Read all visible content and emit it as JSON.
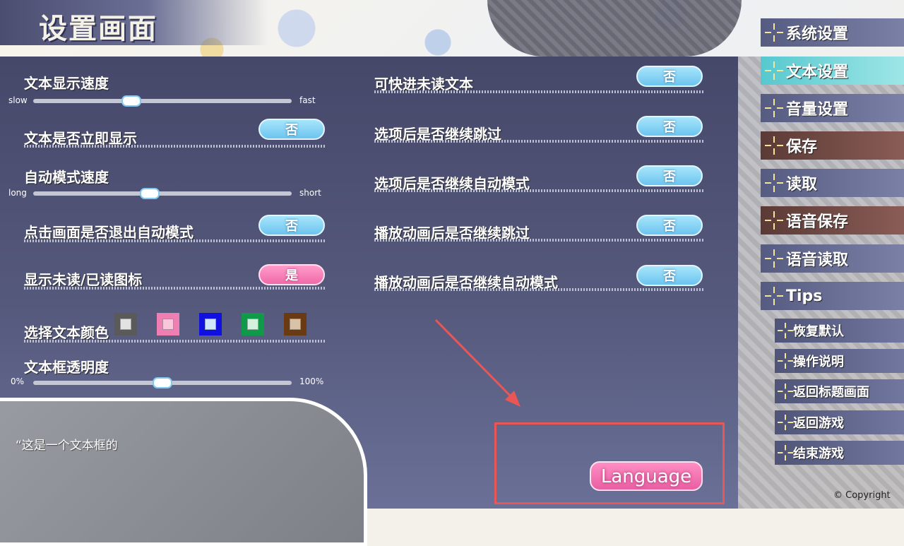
{
  "header": {
    "title": "设置画面"
  },
  "left_settings": {
    "text_speed": {
      "label": "文本显示速度",
      "min_label": "slow",
      "max_label": "fast",
      "value_pct": 38
    },
    "instant_text": {
      "label": "文本是否立即显示",
      "value": "否"
    },
    "auto_speed": {
      "label": "自动模式速度",
      "min_label": "long",
      "max_label": "short",
      "value_pct": 45
    },
    "click_exit_auto": {
      "label": "点击画面是否退出自动模式",
      "value": "否"
    },
    "show_read_icon": {
      "label": "显示未读/已读图标",
      "value": "是"
    },
    "text_color": {
      "label": "选择文本颜色",
      "swatches": [
        {
          "name": "gray",
          "border": "#5a5a5a",
          "fill": "#e2e2e2"
        },
        {
          "name": "pink",
          "border": "#ef7fb2",
          "fill": "#f9c6dc"
        },
        {
          "name": "blue",
          "border": "#1010e0",
          "fill": "#cfe6ff"
        },
        {
          "name": "green",
          "border": "#0f9a4a",
          "fill": "#d2f2dd"
        },
        {
          "name": "brown",
          "border": "#6a3a12",
          "fill": "#d9c2a6"
        }
      ]
    },
    "textbox_opacity": {
      "label": "文本框透明度",
      "min_label": "0%",
      "max_label": "100%",
      "value_pct": 50
    }
  },
  "right_settings": {
    "skip_unread": {
      "label": "可快进未读文本",
      "value": "否"
    },
    "skip_after_choice": {
      "label": "选项后是否继续跳过",
      "value": "否"
    },
    "auto_after_choice": {
      "label": "选项后是否继续自动模式",
      "value": "否"
    },
    "skip_after_movie": {
      "label": "播放动画后是否继续跳过",
      "value": "否"
    },
    "auto_after_movie": {
      "label": "播放动画后是否继续自动模式",
      "value": "否"
    }
  },
  "preview": {
    "text": "“这是一个文本框的"
  },
  "language_button": {
    "label": "Language"
  },
  "menu": {
    "items": [
      {
        "label": "系统设置",
        "style": "blue"
      },
      {
        "label": "文本设置",
        "style": "active"
      },
      {
        "label": "音量设置",
        "style": "blue"
      },
      {
        "label": "保存",
        "style": "brown"
      },
      {
        "label": "读取",
        "style": "blue"
      },
      {
        "label": "语音保存",
        "style": "brown"
      },
      {
        "label": "语音读取",
        "style": "blue"
      },
      {
        "label": "Tips",
        "style": "blue"
      }
    ],
    "sub_items": [
      {
        "label": "恢复默认"
      },
      {
        "label": "操作说明"
      },
      {
        "label": "返回标题画面"
      },
      {
        "label": "返回游戏"
      },
      {
        "label": "结束游戏"
      }
    ]
  },
  "copyright": "© Copyright"
}
